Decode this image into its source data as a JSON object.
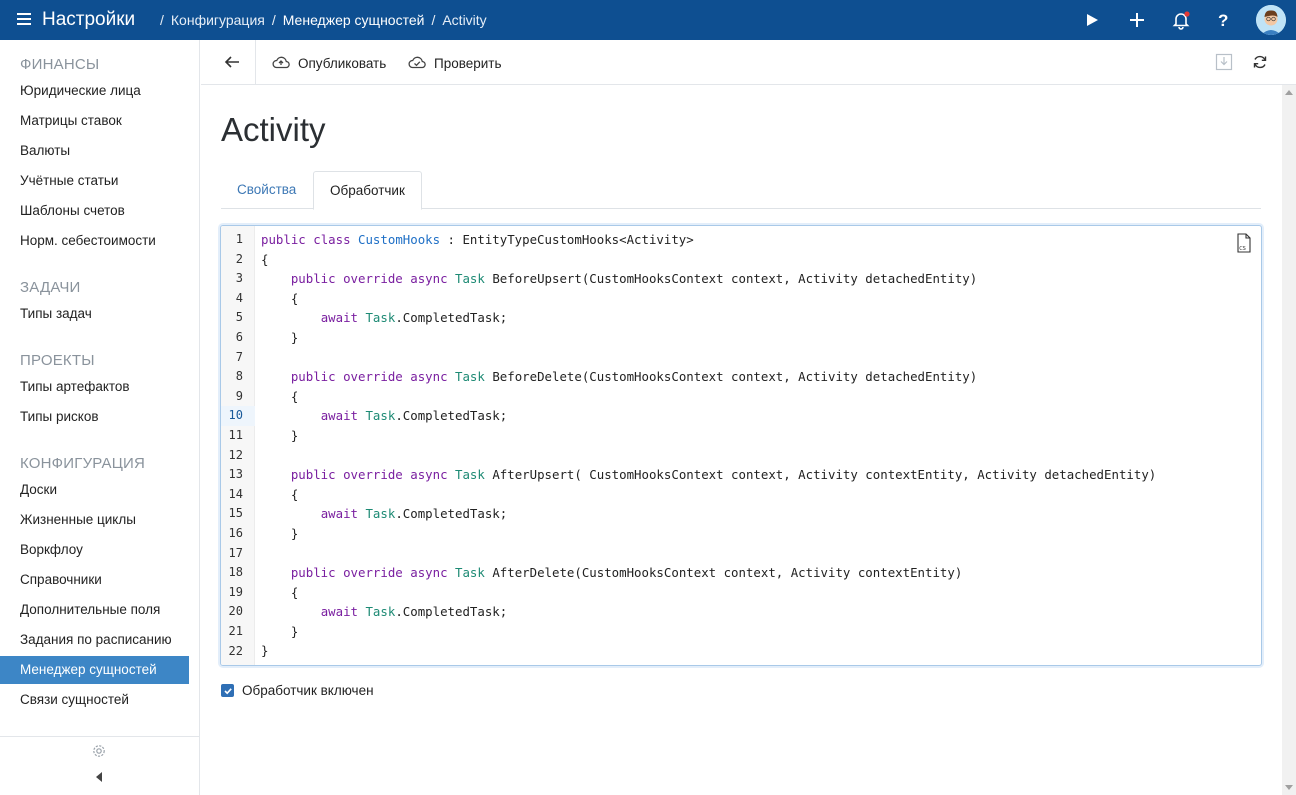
{
  "topbar": {
    "app_title": "Настройки",
    "breadcrumb": [
      "Конфигурация",
      "Менеджер сущностей",
      "Activity"
    ],
    "icons": [
      "play-icon",
      "plus-icon",
      "bell-icon",
      "help-icon"
    ],
    "notification_dot_color": "#e53935",
    "bg_color": "#0e4f91"
  },
  "sidebar": {
    "sections": [
      {
        "title": "ФИНАНСЫ",
        "items": [
          "Юридические лица",
          "Матрицы ставок",
          "Валюты",
          "Учётные статьи",
          "Шаблоны счетов",
          "Норм. себестоимости"
        ]
      },
      {
        "title": "ЗАДАЧИ",
        "items": [
          "Типы задач"
        ]
      },
      {
        "title": "ПРОЕКТЫ",
        "items": [
          "Типы артефактов",
          "Типы рисков"
        ]
      },
      {
        "title": "КОНФИГУРАЦИЯ",
        "items": [
          "Доски",
          "Жизненные циклы",
          "Воркфлоу",
          "Справочники",
          "Дополнительные поля",
          "Задания по расписанию",
          "Менеджер сущностей",
          "Связи сущностей"
        ]
      }
    ],
    "active_item": "Менеджер сущностей",
    "active_color": "#3d86c6"
  },
  "toolbar": {
    "publish_label": "Опубликовать",
    "check_label": "Проверить"
  },
  "page": {
    "title": "Activity",
    "tabs": [
      "Свойства",
      "Обработчик"
    ],
    "active_tab": "Обработчик"
  },
  "editor": {
    "current_line": 10,
    "lines": [
      "public class CustomHooks : EntityTypeCustomHooks<Activity>",
      "{",
      "    public override async Task BeforeUpsert(CustomHooksContext context, Activity detachedEntity)",
      "    {",
      "        await Task.CompletedTask;",
      "    }",
      "",
      "    public override async Task BeforeDelete(CustomHooksContext context, Activity detachedEntity)",
      "    {",
      "        await Task.CompletedTask;",
      "    }",
      "",
      "    public override async Task AfterUpsert( CustomHooksContext context, Activity contextEntity, Activity detachedEntity)",
      "    {",
      "        await Task.CompletedTask;",
      "    }",
      "",
      "    public override async Task AfterDelete(CustomHooksContext context, Activity contextEntity)",
      "    {",
      "        await Task.CompletedTask;",
      "    }",
      "}"
    ]
  },
  "handler_enabled": {
    "label": "Обработчик включен",
    "checked": true
  }
}
